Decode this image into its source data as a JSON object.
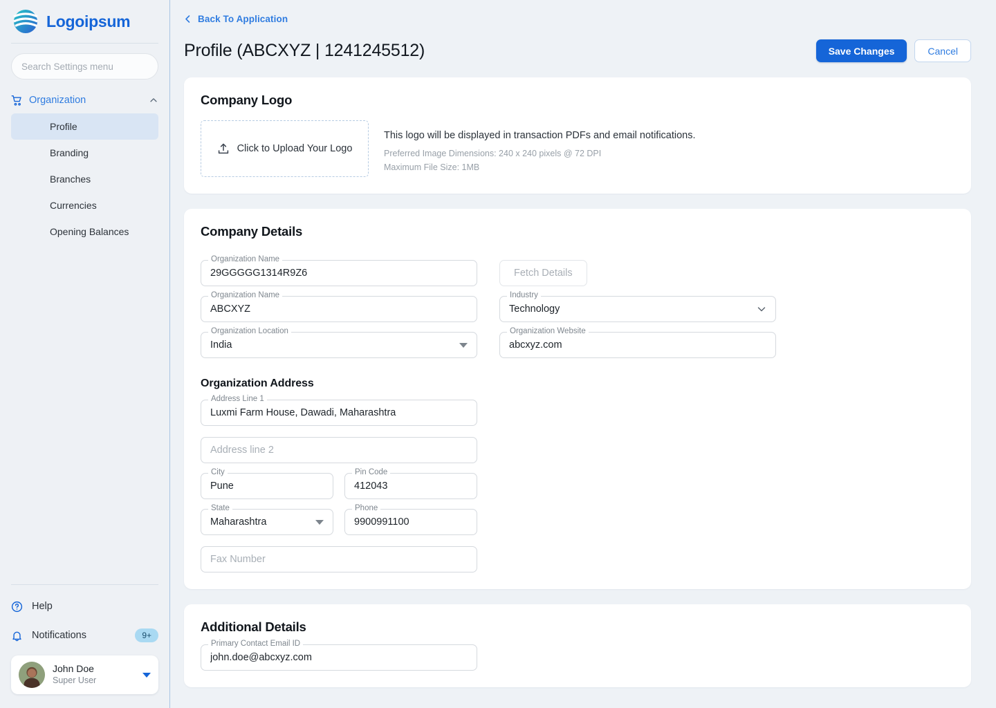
{
  "sidebar": {
    "brand": {
      "name": "Logoipsum",
      "logo_icon": "wave-globe-logo-icon"
    },
    "search": {
      "placeholder": "Search Settings menu",
      "value": ""
    },
    "nav_group": {
      "label": "Organization",
      "icon": "shopping-cart-icon",
      "collapse_icon": "chevron-up-icon",
      "items": [
        {
          "label": "Profile",
          "active": true
        },
        {
          "label": "Branding",
          "active": false
        },
        {
          "label": "Branches",
          "active": false
        },
        {
          "label": "Currencies",
          "active": false
        },
        {
          "label": "Opening Balances",
          "active": false
        }
      ]
    },
    "help": {
      "label": "Help",
      "icon": "question-circle-icon"
    },
    "notifications": {
      "label": "Notifications",
      "icon": "bell-icon",
      "badge": "9+"
    },
    "user": {
      "name": "John Doe",
      "role": "Super User",
      "caret_icon": "caret-down-icon"
    }
  },
  "header": {
    "back_label": "Back To Application",
    "back_icon": "chevron-left-icon",
    "title": "Profile (ABCXYZ | 1241245512)",
    "save_label": "Save Changes",
    "cancel_label": "Cancel"
  },
  "company_logo": {
    "title": "Company Logo",
    "dropzone_label": "Click to Upload Your Logo",
    "dropzone_icon": "upload-icon",
    "description": "This logo will be displayed in transaction PDFs and email notifications.",
    "dimensions_note": "Preferred Image Dimensions: 240 x 240 pixels @ 72 DPI",
    "size_note": "Maximum File Size: 1MB"
  },
  "company_details": {
    "title": "Company Details",
    "fetch_label": "Fetch Details",
    "fields": {
      "tax_id": {
        "label": "Organization Name",
        "value": "29GGGGG1314R9Z6"
      },
      "org_name": {
        "label": "Organization Name",
        "value": "ABCXYZ"
      },
      "industry": {
        "label": "Industry",
        "value": "Technology",
        "icon": "chevron-down-icon"
      },
      "org_location": {
        "label": "Organization Location",
        "value": "India",
        "icon": "caret-down-icon"
      },
      "org_website": {
        "label": "Organization Website",
        "value": "abcxyz.com"
      }
    },
    "address": {
      "title": "Organization Address",
      "line1": {
        "label": "Address Line 1",
        "value": "Luxmi Farm House, Dawadi, Maharashtra"
      },
      "line2": {
        "label": "",
        "value": "",
        "placeholder": "Address line 2"
      },
      "city": {
        "label": "City",
        "value": "Pune"
      },
      "pin_code": {
        "label": "Pin Code",
        "value": "412043"
      },
      "state": {
        "label": "State",
        "value": "Maharashtra",
        "icon": "caret-down-icon"
      },
      "phone": {
        "label": "Phone",
        "value": "9900991100"
      },
      "fax": {
        "label": "",
        "value": "",
        "placeholder": "Fax Number"
      }
    }
  },
  "additional_details": {
    "title": "Additional Details",
    "email": {
      "label": "Primary Contact Email ID",
      "value": "john.doe@abcxyz.com"
    }
  },
  "colors": {
    "accent": "#1565d8",
    "link": "#2f7ce0",
    "page_bg": "#eef2f6",
    "sidebar_bg": "#eef1f5",
    "active_item": "#d9e5f4",
    "badge_bg": "#a9d9f2"
  }
}
